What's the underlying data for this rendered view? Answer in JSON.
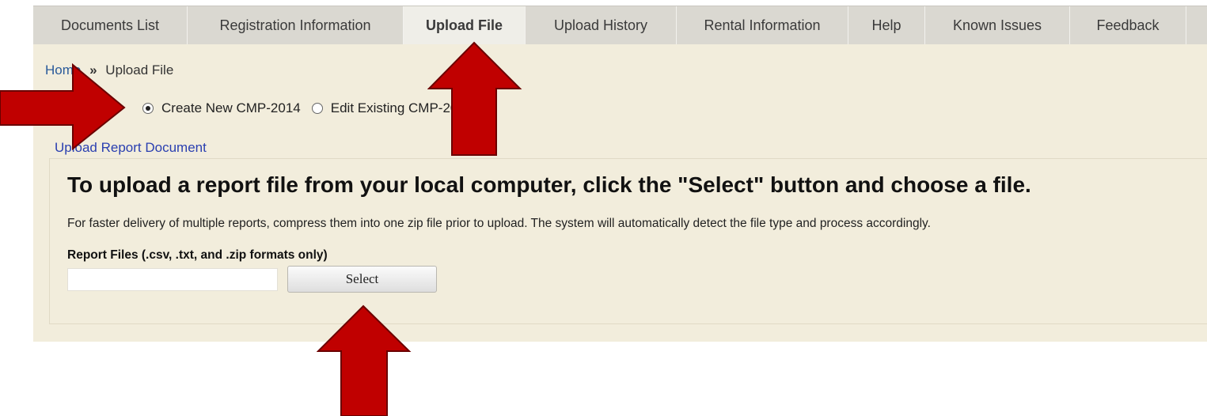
{
  "tabs": [
    {
      "label": "Documents List",
      "active": false
    },
    {
      "label": "Registration Information",
      "active": false
    },
    {
      "label": "Upload File",
      "active": true
    },
    {
      "label": "Upload History",
      "active": false
    },
    {
      "label": "Rental Information",
      "active": false
    },
    {
      "label": "Help",
      "active": false
    },
    {
      "label": "Known Issues",
      "active": false
    },
    {
      "label": "Feedback",
      "active": false
    }
  ],
  "breadcrumb": {
    "home": "Home",
    "separator": "»",
    "current": "Upload File"
  },
  "options": {
    "create_label": "Create New CMP-2014",
    "create_selected": true,
    "edit_label": "Edit Existing CMP-2014",
    "edit_selected": false
  },
  "section": {
    "link": "Upload Report Document"
  },
  "upload": {
    "title": "To upload a report file from your local computer, click the \"Select\" button and choose a file.",
    "description": "For faster delivery of multiple reports, compress them into one zip file prior to upload. The system will automatically detect the file type and process accordingly.",
    "files_label": "Report Files (.csv, .txt, and .zip formats only)",
    "file_value": "",
    "select_label": "Select"
  },
  "colors": {
    "arrow_fill": "#c00000",
    "arrow_stroke": "#6b0000",
    "panel_bg": "#f2eddc",
    "tabbar_bg": "#dad8d1"
  }
}
